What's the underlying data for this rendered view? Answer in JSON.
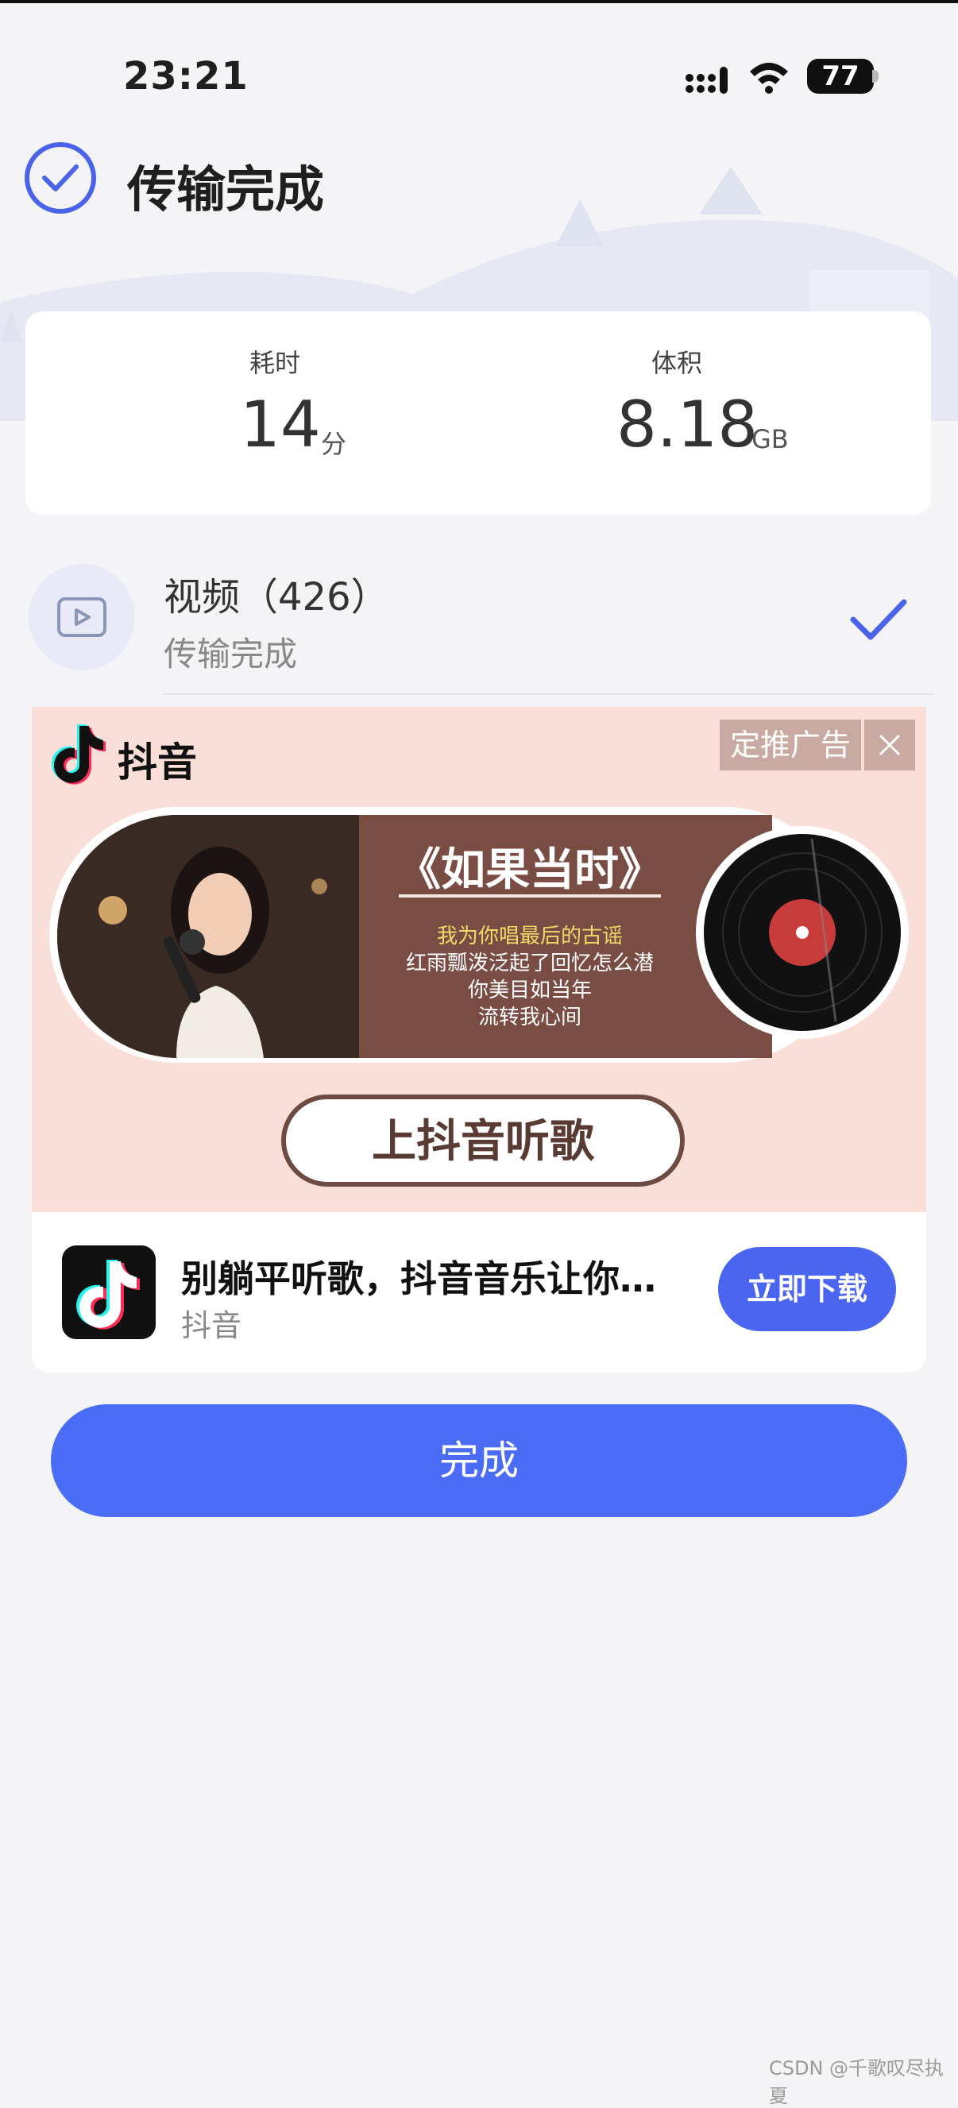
{
  "status_bar": {
    "time": "23:21",
    "battery": "77"
  },
  "header": {
    "title": "传输完成"
  },
  "stats": {
    "duration": {
      "label": "耗时",
      "value": "14",
      "unit": "分"
    },
    "size": {
      "label": "体积",
      "value": "8.18",
      "unit": "GB"
    }
  },
  "transfer_item": {
    "name": "视频（426）",
    "status": "传输完成"
  },
  "ad": {
    "brand": "抖音",
    "tag": "定推广告",
    "song_title": "《如果当时》",
    "lyrics": [
      "我为你唱最后的古谣",
      "红雨瓢泼泛起了回忆怎么潜",
      "你美目如当年",
      "流转我心间"
    ],
    "cta": "上抖音听歌",
    "app_headline": "别躺平听歌，抖音音乐让你…",
    "app_name": "抖音",
    "download_label": "立即下载"
  },
  "done_label": "完成",
  "watermark": "CSDN @千歌叹尽执夏",
  "colors": {
    "accent": "#4a6cf7",
    "ad_bg": "#f9dfd7",
    "ad_brown": "#7a4d44"
  }
}
